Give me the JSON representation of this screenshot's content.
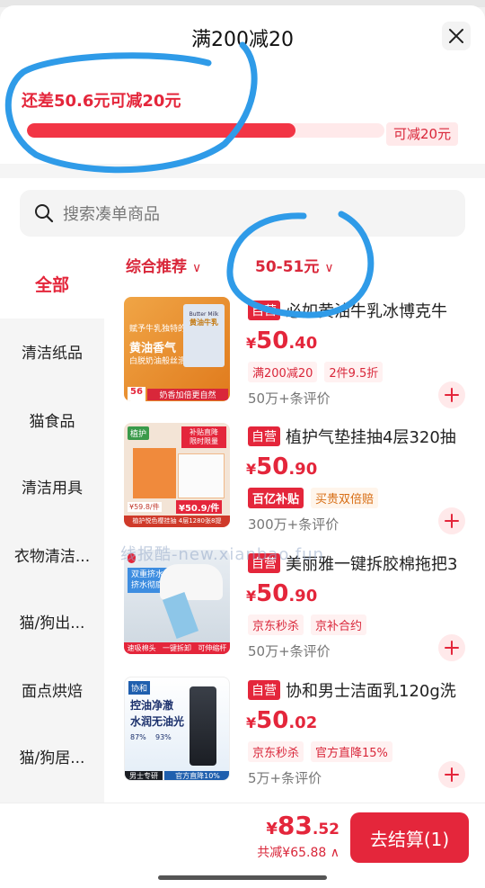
{
  "header": {
    "title": "满200减20"
  },
  "promo": {
    "remain_text": "还差50.6元可减20元",
    "progress": 0.75,
    "reward_tag": "可减20元"
  },
  "search": {
    "placeholder": "搜索凑单商品"
  },
  "sidebar": {
    "items": [
      {
        "label": "全部",
        "active": true
      },
      {
        "label": "清洁纸品"
      },
      {
        "label": "猫食品"
      },
      {
        "label": "清洁用具"
      },
      {
        "label": "衣物清洁..."
      },
      {
        "label": "猫/狗出..."
      },
      {
        "label": "面点烘焙"
      },
      {
        "label": "猫/狗居..."
      }
    ]
  },
  "filters": {
    "sort_label": "综合推荐",
    "price_label": "50-51元"
  },
  "products": [
    {
      "self_tag": "自营",
      "title": "必如黄油牛乳冰博克牛",
      "price_currency": "¥",
      "price_int": "50",
      "price_dec": ".40",
      "tags": [
        "满200减20",
        "2件9.5折"
      ],
      "reviews": "50万+条评价",
      "thumb_text": [
        "赋予牛乳独特的",
        "黄油香气",
        "白脱奶油般丝滑",
        "56",
        "奶香加倍更自然",
        "Butter Milk",
        "黄油牛乳"
      ]
    },
    {
      "self_tag": "自营",
      "title": "植护气垫挂抽4层320抽",
      "price_currency": "¥",
      "price_int": "50",
      "price_dec": ".90",
      "tags": [
        "百亿补贴",
        "买贵双倍赔"
      ],
      "reviews": "300万+条评价",
      "thumb_text": [
        "植护",
        "补贴直降",
        "限时限量",
        "¥59.8/件",
        "¥50.9/件",
        "植护悦色樱挂抽 4层1280张8提"
      ]
    },
    {
      "self_tag": "自营",
      "title": "美丽雅一键拆胶棉拖把3",
      "price_currency": "¥",
      "price_int": "50",
      "price_dec": ".90",
      "tags": [
        "京东秒杀",
        "京补合约"
      ],
      "reviews": "50万+条评价",
      "thumb_text": [
        "双重挤水",
        "挤水彻底",
        "速吸棉头",
        "一键拆卸",
        "可伸缩杆"
      ]
    },
    {
      "self_tag": "自营",
      "title": "协和男士洁面乳120g洗",
      "price_currency": "¥",
      "price_int": "50",
      "price_dec": ".02",
      "tags": [
        "京东秒杀",
        "官方直降15%"
      ],
      "reviews": "5万+条评价",
      "thumb_text": [
        "协和",
        "控油净澈",
        "水润无油光",
        "87%",
        "93%",
        "男士专研",
        "官方直降10%"
      ]
    }
  ],
  "watermark": "线报酷-new.xianbao.fun",
  "footer": {
    "total_currency": "¥",
    "total_int": "83",
    "total_dec": ".52",
    "saved_label": "共减¥65.88",
    "checkout_label": "去结算(1)"
  },
  "colors": {
    "accent": "#e4263b",
    "annotation": "#2f9be8"
  }
}
